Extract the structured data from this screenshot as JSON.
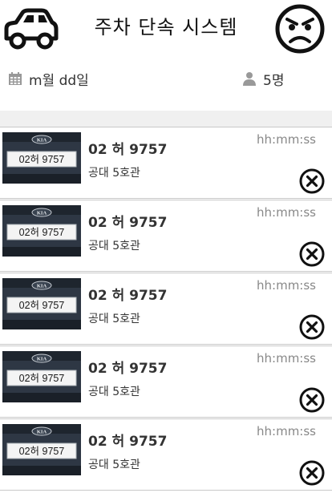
{
  "header": {
    "title": "주차 단속 시스템",
    "date": "m월 dd일",
    "count": "5명"
  },
  "icons": {
    "left": "car-icon",
    "right": "angry-face-icon",
    "date": "calendar-icon",
    "count": "person-icon"
  },
  "violations": [
    {
      "plate": "02 허 9757",
      "plate_in_photo": "02허 9757",
      "badge": "KIA",
      "location": "공대 5호관",
      "time": "hh:mm:ss"
    },
    {
      "plate": "02 허 9757",
      "plate_in_photo": "02허 9757",
      "badge": "KIA",
      "location": "공대 5호관",
      "time": "hh:mm:ss"
    },
    {
      "plate": "02 허 9757",
      "plate_in_photo": "02허 9757",
      "badge": "KIA",
      "location": "공대 5호관",
      "time": "hh:mm:ss"
    },
    {
      "plate": "02 허 9757",
      "plate_in_photo": "02허 9757",
      "badge": "KIA",
      "location": "공대 5호관",
      "time": "hh:mm:ss"
    },
    {
      "plate": "02 허 9757",
      "plate_in_photo": "02허 9757",
      "badge": "KIA",
      "location": "공대 5호관",
      "time": "hh:mm:ss"
    }
  ]
}
